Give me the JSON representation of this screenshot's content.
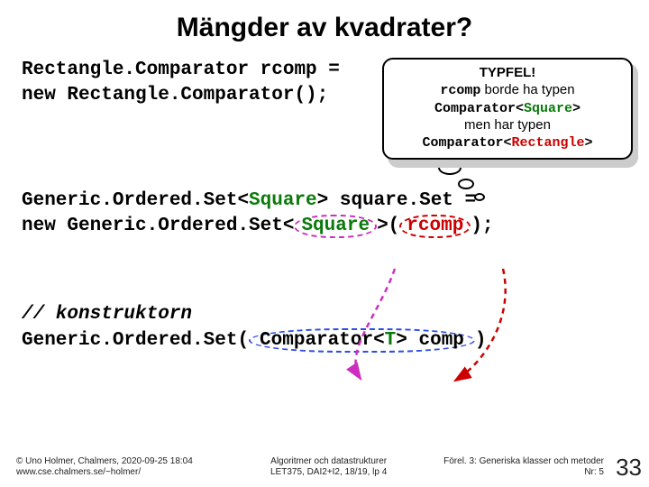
{
  "title": "Mängder av kvadrater?",
  "callout": {
    "l1": "TYPFEL!",
    "l2a": "rcomp",
    "l2b": " borde ha typen",
    "l3a": "Comparator<",
    "l3b": "Square",
    "l3c": ">",
    "l4": "men har typen",
    "l5a": "Comparator<",
    "l5b": "Rectangle",
    "l5c": ">"
  },
  "code1": {
    "l1": "Rectangle.Comparator rcomp =",
    "l2": "   new Rectangle.Comparator();"
  },
  "code2": {
    "l1a": "Generic.Ordered.Set<",
    "l1b": "Square",
    "l1c": "> square.Set =",
    "l2a": "   new Generic.Ordered.Set<",
    "l2b": "Square",
    "l2c": ">(",
    "l2d": "rcomp",
    "l2e": ");"
  },
  "code3": {
    "comment": "// konstruktorn",
    "l2a": "Generic.Ordered.Set(",
    "l2b": "Comparator<",
    "l2c": "T",
    "l2d": "> comp",
    "l2e": ")"
  },
  "footer": {
    "col1a": "© Uno Holmer, Chalmers, 2020-09-25 18:04",
    "col1b": "www.cse.chalmers.se/~holmer/",
    "col2a": "Algoritmer och datastrukturer",
    "col2b": "LET375, DAI2+I2, 18/19, lp 4",
    "col3a": "Förel. 3: Generiska klasser och metoder",
    "col3b": "Nr: 5",
    "page": "33"
  }
}
